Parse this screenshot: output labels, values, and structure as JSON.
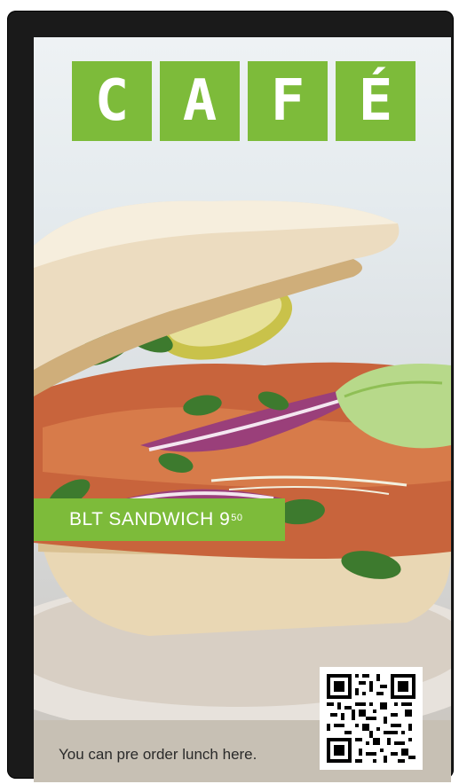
{
  "title": {
    "letters": [
      "C",
      "A",
      "F",
      "É"
    ]
  },
  "menu_item": {
    "name": "BLT SANDWICH",
    "price_whole": "9",
    "price_cents": "50"
  },
  "footer": {
    "message": "You can pre order lunch here."
  },
  "qr": {
    "icon": "qr-code-icon"
  },
  "colors": {
    "brand_green": "#7dbb3a",
    "footer_bg": "#c7c0b4",
    "bezel": "#1a1a1a"
  }
}
